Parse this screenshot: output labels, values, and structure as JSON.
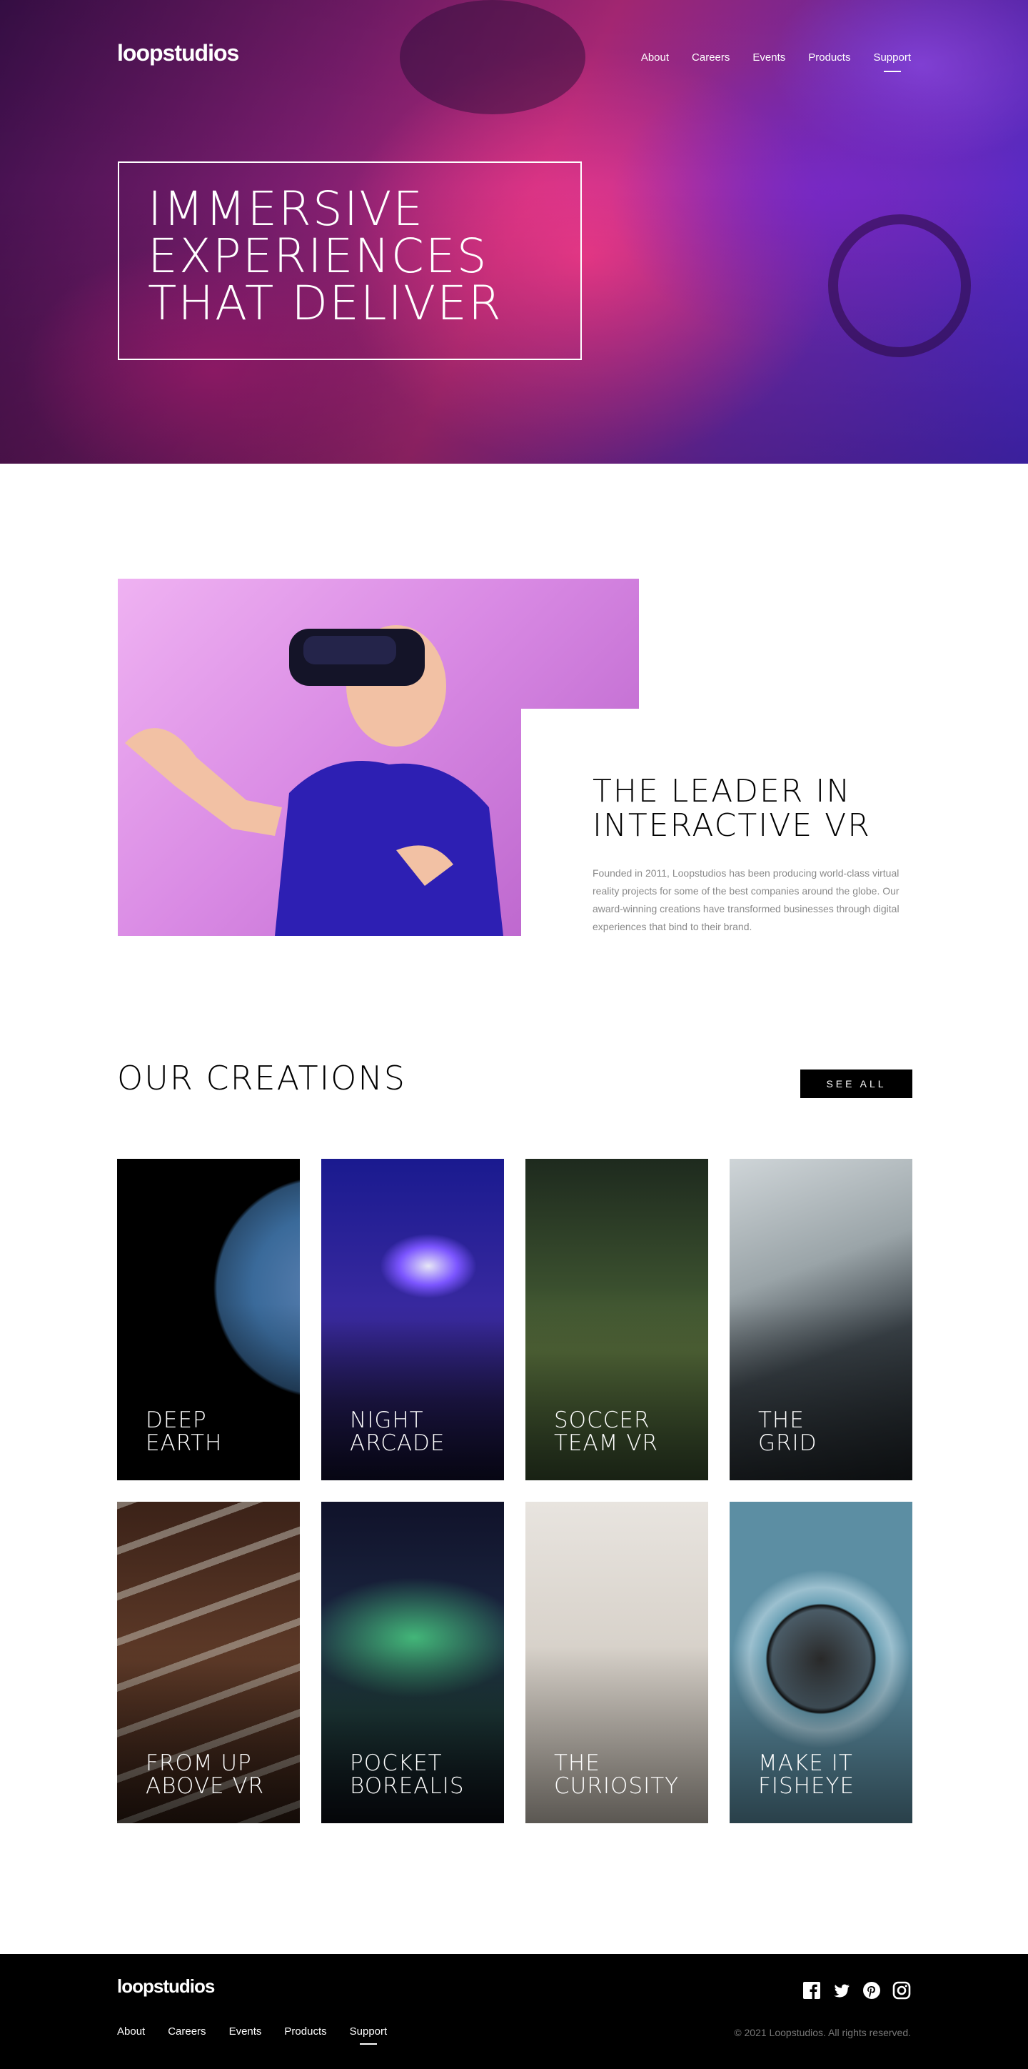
{
  "brand": {
    "name": "loopstudios"
  },
  "nav": {
    "items": [
      {
        "label": "About"
      },
      {
        "label": "Careers"
      },
      {
        "label": "Events"
      },
      {
        "label": "Products"
      },
      {
        "label": "Support"
      }
    ],
    "active": "Support"
  },
  "hero": {
    "headline_lines": [
      "IMMERSIVE",
      "EXPERIENCES",
      "THAT DELIVER"
    ]
  },
  "interactive": {
    "heading": "THE LEADER IN INTERACTIVE VR",
    "body": "Founded in 2011, Loopstudios has been producing world-class virtual reality projects for some of the best companies around the globe. Our award-winning creations have transformed businesses through digital experiences that bind to their brand."
  },
  "creations": {
    "heading": "OUR CREATIONS",
    "see_all_label": "SEE ALL",
    "items": [
      {
        "title": "DEEP\nEARTH"
      },
      {
        "title": "NIGHT\nARCADE"
      },
      {
        "title": "SOCCER\nTEAM VR"
      },
      {
        "title": "THE\nGRID"
      },
      {
        "title": "FROM UP\nABOVE VR"
      },
      {
        "title": "POCKET\nBOREALIS"
      },
      {
        "title": "THE\nCURIOSITY"
      },
      {
        "title": "MAKE IT\nFISHEYE"
      }
    ]
  },
  "footer": {
    "copyright": "© 2021 Loopstudios. All rights reserved.",
    "socials": [
      "facebook-icon",
      "twitter-icon",
      "pinterest-icon",
      "instagram-icon"
    ]
  },
  "colors": {
    "accent": "#000000",
    "text_muted": "#8a8a8a",
    "white": "#ffffff"
  }
}
